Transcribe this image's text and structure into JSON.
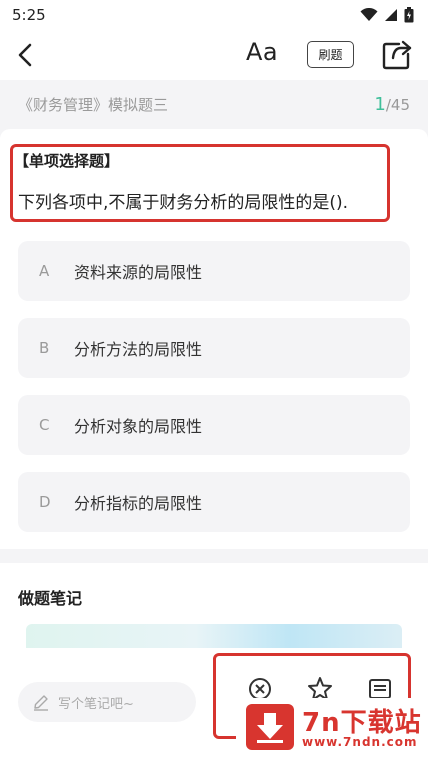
{
  "status_bar": {
    "time": "5:25"
  },
  "nav": {
    "font_label": "Aa",
    "practice_label": "刷题"
  },
  "paper": {
    "title": "《财务管理》模拟题三",
    "current": "1",
    "total": "/45"
  },
  "question": {
    "type": "【单项选择题】",
    "text": "下列各项中,不属于财务分析的局限性的是().",
    "options": [
      {
        "letter": "A",
        "text": "资料来源的局限性"
      },
      {
        "letter": "B",
        "text": "分析方法的局限性"
      },
      {
        "letter": "C",
        "text": "分析对象的局限性"
      },
      {
        "letter": "D",
        "text": "分析指标的局限性"
      }
    ]
  },
  "notes": {
    "title": "做题笔记",
    "placeholder": "写个笔记吧~"
  },
  "watermark": {
    "name": "7n下载站",
    "url": "www.7ndn.com"
  },
  "colors": {
    "accent": "#3fbf9a",
    "highlight": "#d6342f",
    "brand": "#d8352f"
  },
  "icons": {
    "back": "chevron-left-icon",
    "share": "share-icon",
    "pen": "pen-icon",
    "action1": "close-circle-icon",
    "action2": "star-icon",
    "action3": "answer-sheet-icon"
  }
}
